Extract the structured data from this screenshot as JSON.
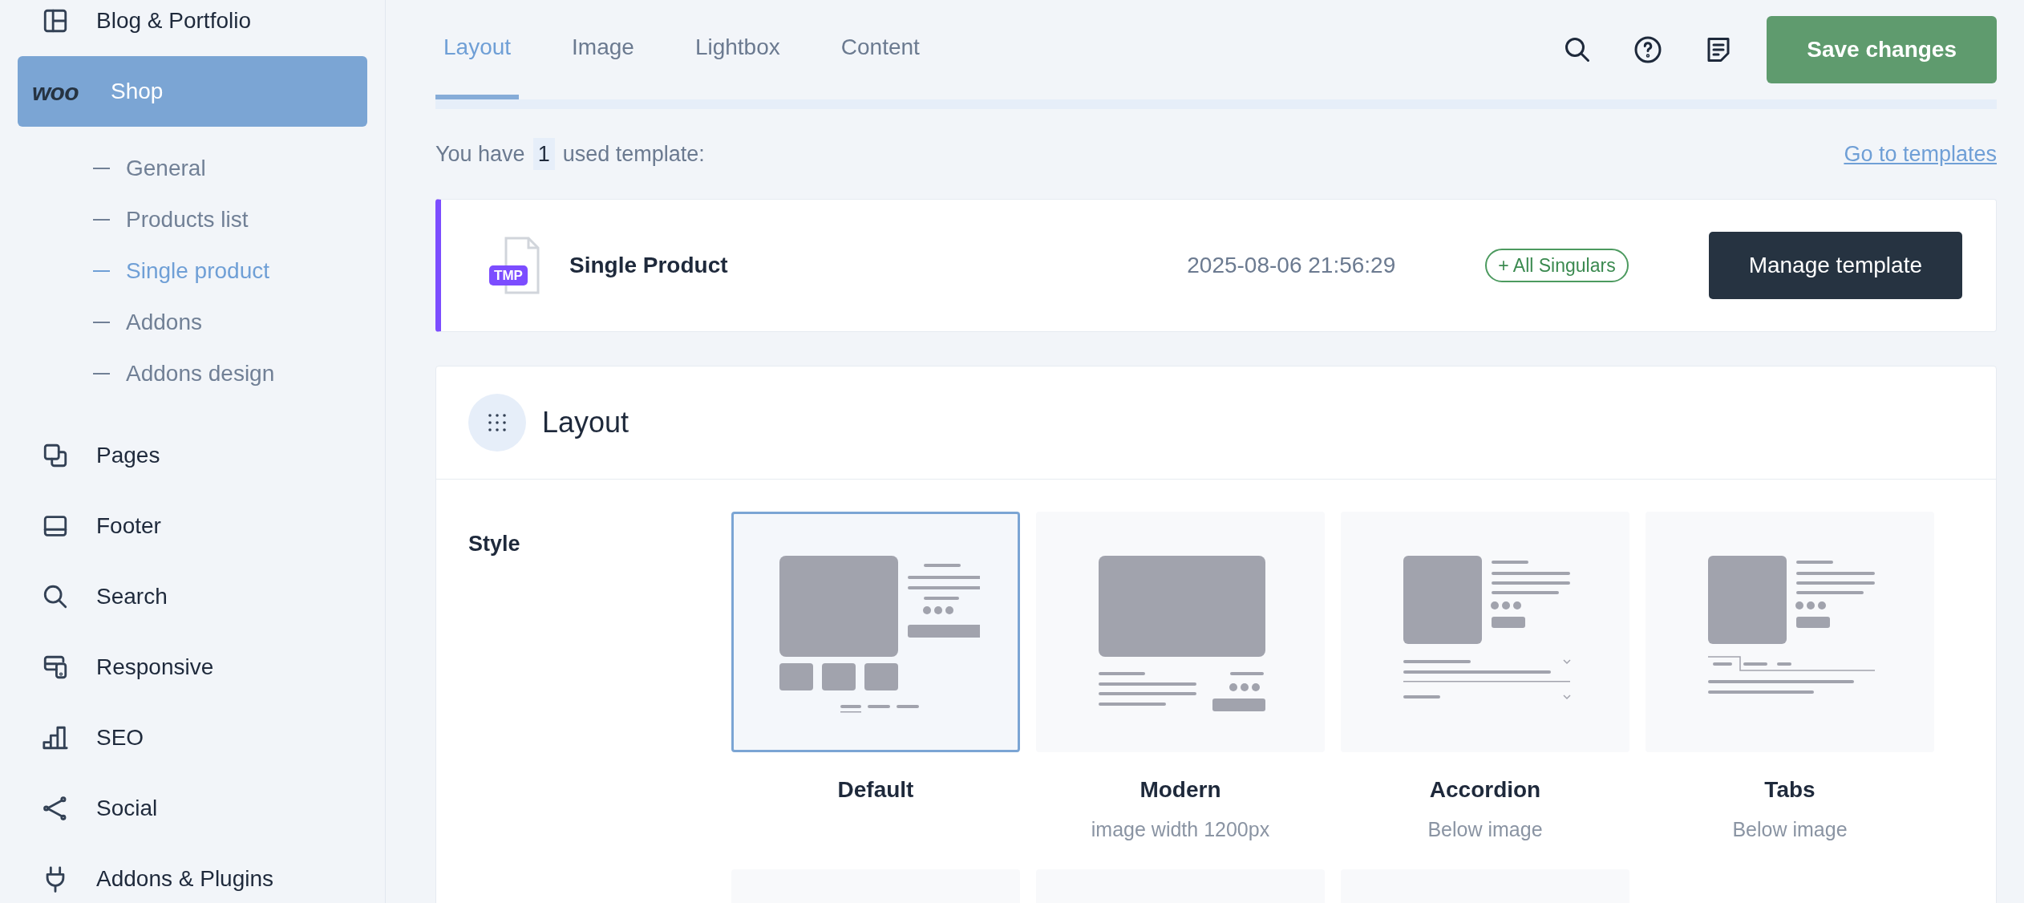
{
  "sidebar": {
    "items": [
      {
        "label": "Blog & Portfolio",
        "selected": false
      },
      {
        "label": "Shop",
        "logo_text": "woo",
        "selected": true,
        "children": [
          {
            "label": "General",
            "selected": false
          },
          {
            "label": "Products list",
            "selected": false
          },
          {
            "label": "Single product",
            "selected": true
          },
          {
            "label": "Addons",
            "selected": false
          },
          {
            "label": "Addons design",
            "selected": false
          }
        ]
      },
      {
        "label": "Pages",
        "selected": false
      },
      {
        "label": "Footer",
        "selected": false
      },
      {
        "label": "Search",
        "selected": false
      },
      {
        "label": "Responsive",
        "selected": false
      },
      {
        "label": "SEO",
        "selected": false
      },
      {
        "label": "Social",
        "selected": false
      },
      {
        "label": "Addons & Plugins",
        "selected": false
      }
    ]
  },
  "tabs": [
    {
      "label": "Layout",
      "selected": true
    },
    {
      "label": "Image",
      "selected": false
    },
    {
      "label": "Lightbox",
      "selected": false
    },
    {
      "label": "Content",
      "selected": false
    }
  ],
  "save_button": "Save changes",
  "templates": {
    "prefix": "You have",
    "count": "1",
    "suffix": "used template:",
    "link": "Go to templates",
    "items": [
      {
        "badge": "TMP",
        "name": "Single Product",
        "date": "2025-08-06 21:56:29",
        "scope": "+ All Singulars",
        "button": "Manage template"
      }
    ]
  },
  "layout_section": {
    "title": "Layout",
    "field_label": "Style",
    "styles": [
      {
        "kind": "default",
        "label": "Default",
        "selected": true
      },
      {
        "kind": "modern",
        "label": "Modern",
        "sublabel": "image width 1200px",
        "selected": false
      },
      {
        "kind": "accordion",
        "label": "Accordion",
        "sublabel": "Below image",
        "selected": false
      },
      {
        "kind": "tabs",
        "label": "Tabs",
        "sublabel": "Below image",
        "selected": false
      }
    ]
  }
}
